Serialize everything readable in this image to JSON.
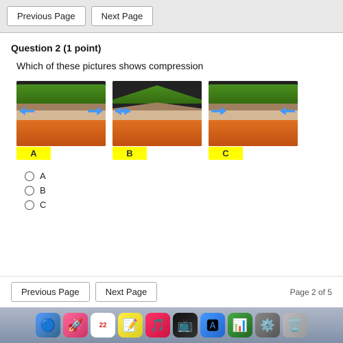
{
  "toolbar": {
    "prev_label": "Previous Page",
    "next_label": "Next Page"
  },
  "question": {
    "number": "Question 2",
    "points": "(1 point)",
    "text": "Which of these pictures shows compression"
  },
  "images": [
    {
      "label": "A",
      "type": "tension"
    },
    {
      "label": "B",
      "type": "fold"
    },
    {
      "label": "C",
      "type": "compression"
    }
  ],
  "options": [
    {
      "label": "A"
    },
    {
      "label": "B"
    },
    {
      "label": "C"
    }
  ],
  "bottom": {
    "prev_label": "Previous Page",
    "next_label": "Next Page",
    "page_indicator": "Page 2 of 5"
  }
}
